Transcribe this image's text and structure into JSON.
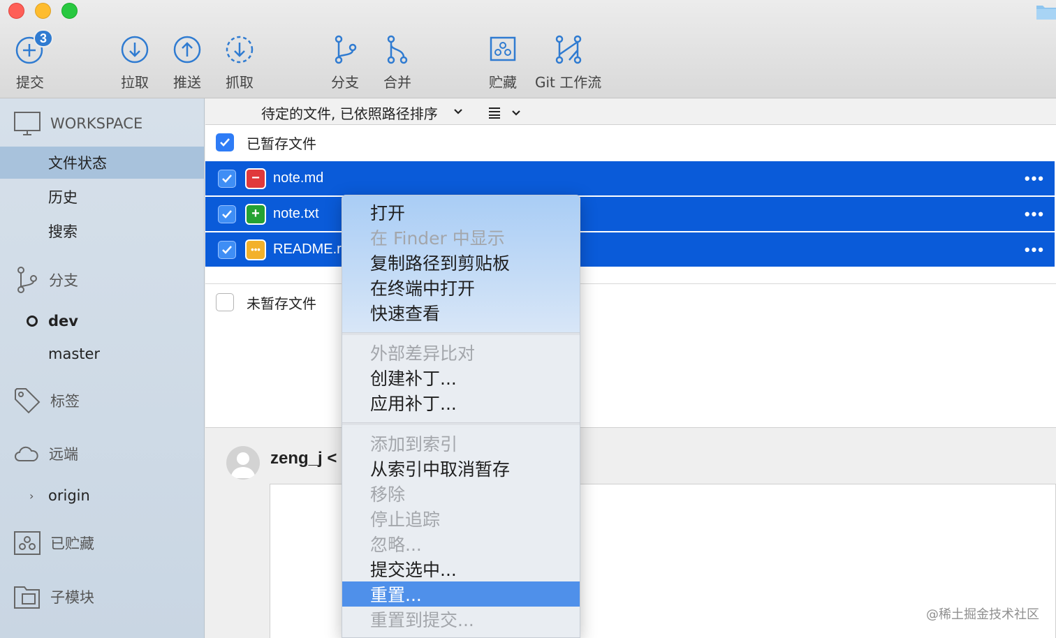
{
  "toolbar": {
    "commit": {
      "label": "提交",
      "badge": "3"
    },
    "pull": {
      "label": "拉取"
    },
    "push": {
      "label": "推送"
    },
    "fetch": {
      "label": "抓取"
    },
    "branch": {
      "label": "分支"
    },
    "merge": {
      "label": "合并"
    },
    "stash": {
      "label": "贮藏"
    },
    "gitflow": {
      "label": "Git 工作流"
    }
  },
  "sidebar": {
    "workspace": "WORKSPACE",
    "items": {
      "file_status": "文件状态",
      "history": "历史",
      "search": "搜索"
    },
    "branches": {
      "label": "分支",
      "current": "dev",
      "other": "master"
    },
    "tags": {
      "label": "标签"
    },
    "remotes": {
      "label": "远端",
      "origin": "origin"
    },
    "stashes": {
      "label": "已贮藏"
    },
    "submodules": {
      "label": "子模块"
    }
  },
  "sortbar": {
    "label": "待定的文件, 已依照路径排序"
  },
  "staged": {
    "label": "已暂存文件",
    "files": [
      {
        "name": "note.md",
        "status": "removed",
        "icon": "minus-icon"
      },
      {
        "name": "note.txt",
        "status": "added",
        "icon": "plus-icon"
      },
      {
        "name": "README.r",
        "status": "modified",
        "icon": "ellipsis-icon"
      }
    ]
  },
  "unstaged": {
    "label": "未暂存文件"
  },
  "commit": {
    "author": "zeng_j <"
  },
  "context_menu": {
    "group1": [
      "打开",
      "在 Finder 中显示",
      "复制路径到剪贴板",
      "在终端中打开",
      "快速查看"
    ],
    "group2": [
      "外部差异比对",
      "创建补丁...",
      "应用补丁..."
    ],
    "group3": [
      "添加到索引",
      "从索引中取消暂存",
      "移除",
      "停止追踪",
      "忽略...",
      "提交选中...",
      "重置...",
      "重置到提交..."
    ]
  },
  "colors": {
    "selection": "#0a5bd9",
    "accent": "#2e7cf6",
    "menu_highlight": "#4f90ea"
  },
  "watermark": "@稀土掘金技术社区"
}
